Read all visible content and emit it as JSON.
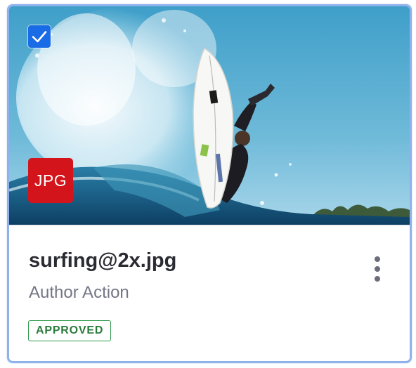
{
  "asset_card": {
    "selected": true,
    "file_type_badge": "JPG",
    "file_name": "surfing@2x.jpg",
    "subtitle": "Author Action",
    "status_label": "APPROVED",
    "thumbnail_description": "surfer on white surfboard riding a breaking wave",
    "icons": {
      "checkbox": "checkmark-icon",
      "menu": "more-vertical-icon"
    },
    "colors": {
      "border": "#8fb2ec",
      "checkbox": "#1a6ce6",
      "badge": "#d3141a",
      "status": "#2f9a4c",
      "title": "#2b2b33",
      "subtitle": "#747685"
    }
  }
}
